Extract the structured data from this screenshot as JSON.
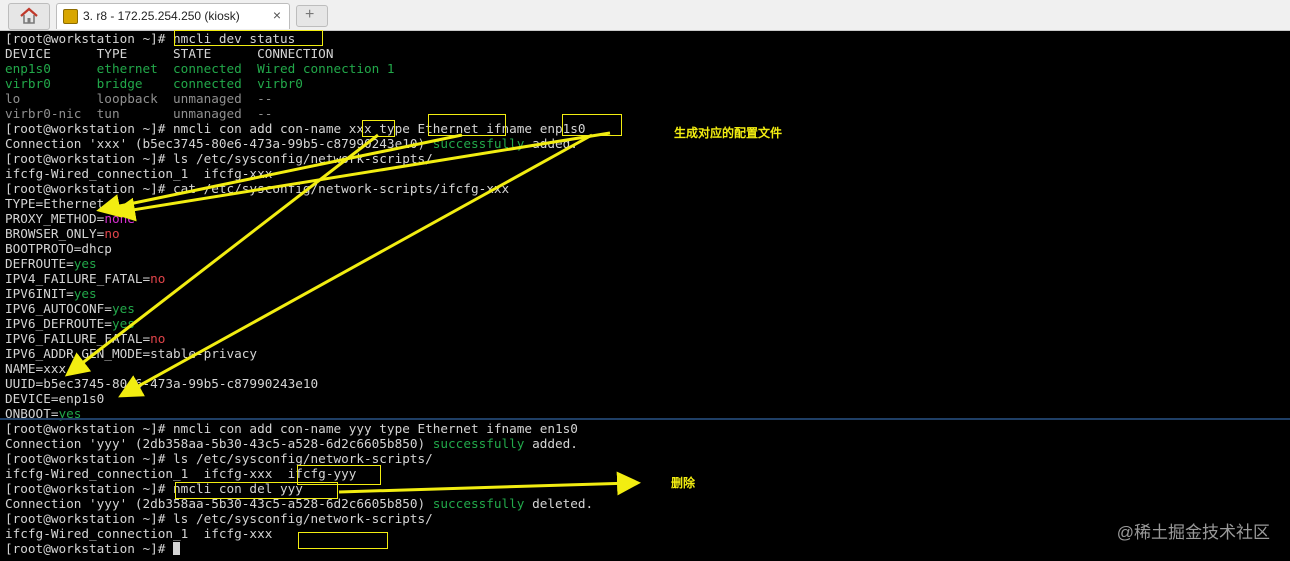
{
  "tab": {
    "title": "3. r8 - 172.25.254.250 (kiosk)",
    "close": "×",
    "new_tab": "+"
  },
  "terminal": {
    "lines": [
      [
        {
          "t": "[root@workstation ~]# nmcli dev status"
        }
      ],
      [
        {
          "t": "DEVICE      TYPE      STATE      CONNECTION"
        }
      ],
      [
        {
          "t": "enp1s0      ethernet  connected  Wired connection 1",
          "c": "g"
        }
      ],
      [
        {
          "t": "virbr0      bridge    connected  virbr0",
          "c": "g"
        }
      ],
      [
        {
          "t": "lo          loopback  unmanaged  --",
          "c": "gr"
        }
      ],
      [
        {
          "t": "virbr0-nic  tun       unmanaged  --",
          "c": "gr"
        }
      ],
      [
        {
          "t": "[root@workstation ~]# nmcli con add con-name xxx type Ethernet ifname enp1s0"
        }
      ],
      [
        {
          "t": "Connection 'xxx' (b5ec3745-80e6-473a-99b5-c87990243e10) "
        },
        {
          "t": "successfully",
          "c": "g"
        },
        {
          "t": " added."
        }
      ],
      [
        {
          "t": "[root@workstation ~]# ls /etc/sysconfig/network-scripts/"
        }
      ],
      [
        {
          "t": "ifcfg-Wired_connection_1  ifcfg-xxx"
        }
      ],
      [
        {
          "t": "[root@workstation ~]# cat /etc/sysconfig/network-scripts/ifcfg-xxx"
        }
      ],
      [
        {
          "t": "TYPE=Ethernet"
        }
      ],
      [
        {
          "t": "PROXY_METHOD="
        },
        {
          "t": "none",
          "c": "m"
        }
      ],
      [
        {
          "t": "BROWSER_ONLY="
        },
        {
          "t": "no",
          "c": "r"
        }
      ],
      [
        {
          "t": "BOOTPROTO=dhcp"
        }
      ],
      [
        {
          "t": "DEFROUTE="
        },
        {
          "t": "yes",
          "c": "g"
        }
      ],
      [
        {
          "t": "IPV4_FAILURE_FATAL="
        },
        {
          "t": "no",
          "c": "r"
        }
      ],
      [
        {
          "t": "IPV6INIT="
        },
        {
          "t": "yes",
          "c": "g"
        }
      ],
      [
        {
          "t": "IPV6_AUTOCONF="
        },
        {
          "t": "yes",
          "c": "g"
        }
      ],
      [
        {
          "t": "IPV6_DEFROUTE="
        },
        {
          "t": "yes",
          "c": "g"
        }
      ],
      [
        {
          "t": "IPV6_FAILURE_FATAL="
        },
        {
          "t": "no",
          "c": "r"
        }
      ],
      [
        {
          "t": "IPV6_ADDR_GEN_MODE=stable-privacy"
        }
      ],
      [
        {
          "t": "NAME=xxx"
        }
      ],
      [
        {
          "t": "UUID=b5ec3745-80e6-473a-99b5-c87990243e10"
        }
      ],
      [
        {
          "t": "DEVICE=enp1s0"
        }
      ],
      [
        {
          "t": "ONBOOT="
        },
        {
          "t": "yes",
          "c": "g"
        }
      ],
      [
        {
          "t": "[root@workstation ~]# nmcli con add con-name yyy type Ethernet ifname en1s0"
        }
      ],
      [
        {
          "t": "Connection 'yyy' (2db358aa-5b30-43c5-a528-6d2c6605b850) "
        },
        {
          "t": "successfully",
          "c": "g"
        },
        {
          "t": " added."
        }
      ],
      [
        {
          "t": "[root@workstation ~]# ls /etc/sysconfig/network-scripts/"
        }
      ],
      [
        {
          "t": "ifcfg-Wired_connection_1  ifcfg-xxx  ifcfg-yyy"
        }
      ],
      [
        {
          "t": "[root@workstation ~]# nmcli con del yyy"
        }
      ],
      [
        {
          "t": "Connection 'yyy' (2db358aa-5b30-43c5-a528-6d2c6605b850) "
        },
        {
          "t": "successfully",
          "c": "g"
        },
        {
          "t": " deleted."
        }
      ],
      [
        {
          "t": "[root@workstation ~]# ls /etc/sysconfig/network-scripts/"
        }
      ],
      [
        {
          "t": "ifcfg-Wired_connection_1  ifcfg-xxx"
        }
      ],
      [
        {
          "t": "[root@workstation ~]# "
        }
      ]
    ]
  },
  "annotations": {
    "generate_config": "生成对应的配置文件",
    "delete": "删除"
  },
  "watermark": "@稀土掘金技术社区",
  "colors": {
    "annotation": "#f2ed11",
    "green": "#22a84a",
    "gray": "#8f8f8f",
    "magenta": "#d52fcf",
    "red": "#e0444a",
    "text": "#d4d4d4",
    "background": "#000000"
  }
}
